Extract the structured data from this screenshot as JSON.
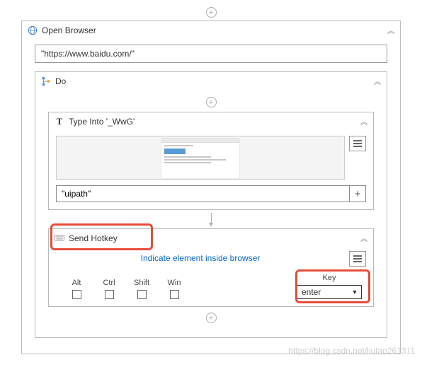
{
  "openBrowser": {
    "title": "Open Browser",
    "url": "\"https://www.baidu.com/\""
  },
  "do": {
    "title": "Do"
  },
  "typeInto": {
    "title": "Type Into '_WwG'",
    "value": "\"uipath\""
  },
  "sendHotkey": {
    "title": "Send Hotkey",
    "indicateLink": "Indicate element inside browser",
    "modifiers": {
      "alt": "Alt",
      "ctrl": "Ctrl",
      "shift": "Shift",
      "win": "Win"
    },
    "keyLabel": "Key",
    "keyValue": "enter"
  },
  "watermark": "https://blog.csdn.net/liutao261311"
}
